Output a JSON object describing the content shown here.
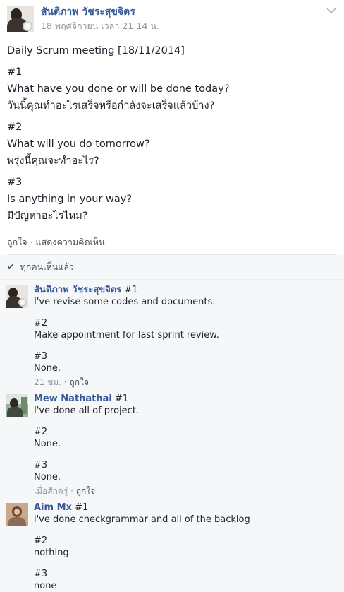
{
  "post": {
    "author": "สันติภาพ วัชระสุขจิตร",
    "time": "18 พฤศจิกายน เวลา 21:14 น.",
    "lines": [
      "Daily Scrum meeting [18/11/2014]",
      "#1",
      "What have you done or will be done today?",
      "วันนี้คุณทำอะไรเสร็จหรือกำลังจะเสร็จแล้วบ้าง?",
      "#2",
      "What will you do tomorrow?",
      "พรุ่งนี้คุณจะทำอะไร?",
      "#3",
      "Is anything in your way?",
      "มีปัญหาอะไรไหม?"
    ],
    "like_label": "ถูกใจ",
    "separator": "·",
    "comment_label": "แสดงความคิดเห็น"
  },
  "seen": {
    "check_icon": "✔",
    "label": "ทุกคนเห็นแล้ว"
  },
  "comments": [
    {
      "author": "สันติภาพ วัชระสุขจิตร",
      "avatar": "person-with-camera-avatar",
      "lines": [
        "#1",
        "I've revise some codes and documents.",
        "",
        "#2",
        "Make appointment for last sprint review.",
        "",
        "#3",
        "None."
      ],
      "time": "21 ชม.",
      "like": "ถูกใจ"
    },
    {
      "author": "Mew Nathathai",
      "avatar": "person-in-forest-avatar",
      "lines": [
        "#1",
        "I've done all of project.",
        "",
        "#2",
        "None.",
        "",
        "#3",
        "None."
      ],
      "time": "เมื่อสักครู่",
      "like": "ถูกใจ"
    },
    {
      "author": "Aim Mx",
      "avatar": "woman-portrait-avatar",
      "lines": [
        "#1",
        "i've done checkgrammar and all of the backlog",
        "",
        "#2",
        "nothing",
        "",
        "#3",
        "none"
      ],
      "time": "",
      "like": ""
    }
  ]
}
